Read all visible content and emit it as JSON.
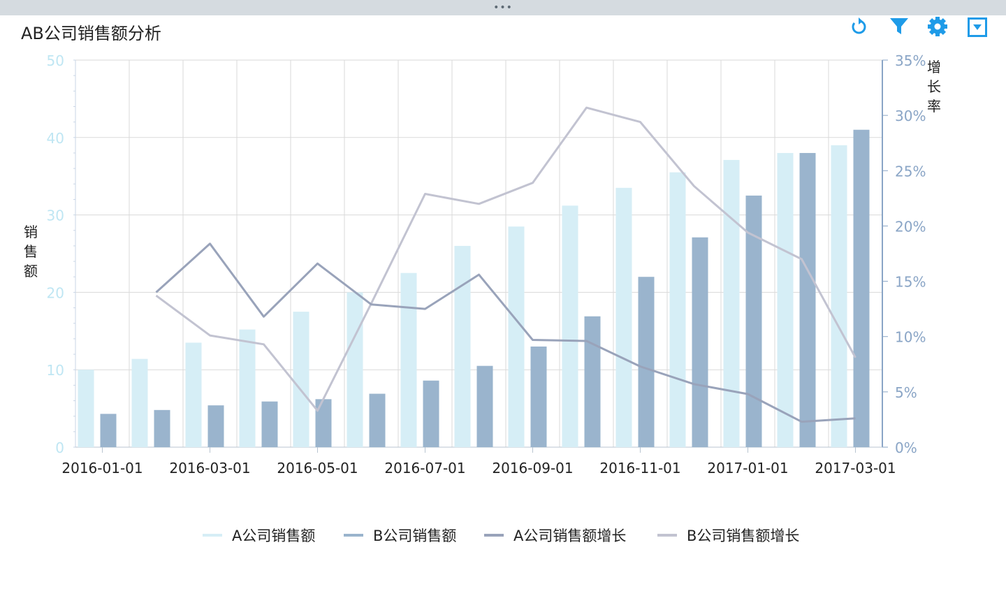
{
  "title": "AB公司销售额分析",
  "toolbar": {
    "icons": [
      "refresh-icon",
      "filter-icon",
      "gear-icon",
      "dropdown-icon"
    ],
    "color": "#1e9be8"
  },
  "axis_labels": {
    "y_left": "销售额",
    "y_right": "增长率"
  },
  "colors": {
    "a_bar": "#d6eef6",
    "b_bar": "#9ab4cd",
    "a_line": "#99a3ba",
    "b_line": "#c2c3d1",
    "grid": "#dadada",
    "left_tick": "#bfe6f3",
    "right_tick": "#8aa5c6"
  },
  "chart_data": {
    "type": "bar",
    "title": "AB公司销售额分析",
    "x": [
      "2016-01-01",
      "2016-02-01",
      "2016-03-01",
      "2016-04-01",
      "2016-05-01",
      "2016-06-01",
      "2016-07-01",
      "2016-08-01",
      "2016-09-01",
      "2016-10-01",
      "2016-11-01",
      "2016-12-01",
      "2017-01-01",
      "2017-02-01",
      "2017-03-01"
    ],
    "x_tick_labels": [
      "2016-01-01",
      "2016-03-01",
      "2016-05-01",
      "2016-07-01",
      "2016-09-01",
      "2016-11-01",
      "2017-01-01",
      "2017-03-01"
    ],
    "ylabel": "销售额",
    "ylim": [
      0,
      50
    ],
    "y_ticks": [
      "0",
      "10",
      "20",
      "30",
      "40",
      "50"
    ],
    "y2label": "增长率",
    "y2lim": [
      0,
      35
    ],
    "y2_ticks": [
      "0%",
      "5%",
      "10%",
      "15%",
      "20%",
      "25%",
      "30%",
      "35%"
    ],
    "grid": true,
    "legend_position": "bottom",
    "series": [
      {
        "name": "A公司销售额",
        "type": "bar",
        "axis": "left",
        "values": [
          10.0,
          11.4,
          13.5,
          15.2,
          17.5,
          20.0,
          22.5,
          26.0,
          28.5,
          31.2,
          33.5,
          35.5,
          37.1,
          38.0,
          39.0
        ]
      },
      {
        "name": "B公司销售额",
        "type": "bar",
        "axis": "left",
        "values": [
          4.3,
          4.8,
          5.4,
          5.9,
          6.2,
          6.9,
          8.6,
          10.5,
          13.0,
          16.9,
          22.0,
          27.1,
          32.5,
          38.0,
          41.0
        ]
      },
      {
        "name": "A公司销售额增长",
        "type": "line",
        "axis": "right",
        "values": [
          null,
          14.0,
          18.4,
          11.8,
          16.6,
          12.9,
          12.5,
          15.6,
          9.7,
          9.6,
          7.3,
          5.7,
          4.8,
          2.3,
          2.6
        ]
      },
      {
        "name": "B公司销售额增长",
        "type": "line",
        "axis": "right",
        "values": [
          null,
          13.7,
          10.1,
          9.3,
          3.3,
          13.0,
          22.9,
          22.0,
          23.9,
          30.7,
          29.4,
          23.6,
          19.4,
          17.0,
          8.1
        ]
      }
    ]
  },
  "legend": [
    {
      "label": "A公司销售额",
      "color": "#d6eef6"
    },
    {
      "label": "B公司销售额",
      "color": "#9ab4cd"
    },
    {
      "label": "A公司销售额增长",
      "color": "#99a3ba"
    },
    {
      "label": "B公司销售额增长",
      "color": "#c2c3d1"
    }
  ]
}
